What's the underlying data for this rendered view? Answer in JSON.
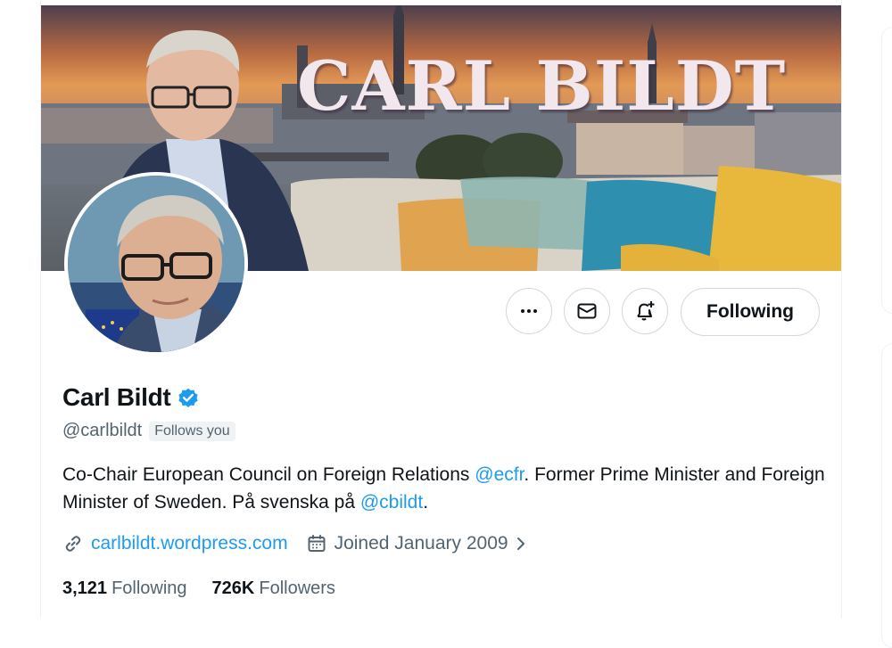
{
  "banner": {
    "title": "CARL BILDT"
  },
  "avatar": {
    "alt": "Carl Bildt profile photo"
  },
  "actions": {
    "more_icon": "more-horizontal-icon",
    "message_icon": "envelope-icon",
    "notify_icon": "bell-plus-icon",
    "following_label": "Following"
  },
  "profile": {
    "name": "Carl Bildt",
    "handle": "@carlbildt",
    "follows_you": "Follows you",
    "bio": {
      "part1": "Co-Chair European Council on Foreign Relations ",
      "mention1": "@ecfr",
      "part2": ". Former Prime Minister and Foreign Minister of Sweden. På svenska på ",
      "mention2": "@cbildt",
      "part3": "."
    },
    "website": "carlbildt.wordpress.com",
    "joined": "Joined January 2009",
    "stats": {
      "following_count": "3,121",
      "following_label": "Following",
      "followers_count": "726K",
      "followers_label": "Followers"
    }
  },
  "colors": {
    "accent": "#1d9bf0",
    "text": "#0f1419",
    "muted": "#536471",
    "border": "#cfd9de"
  }
}
